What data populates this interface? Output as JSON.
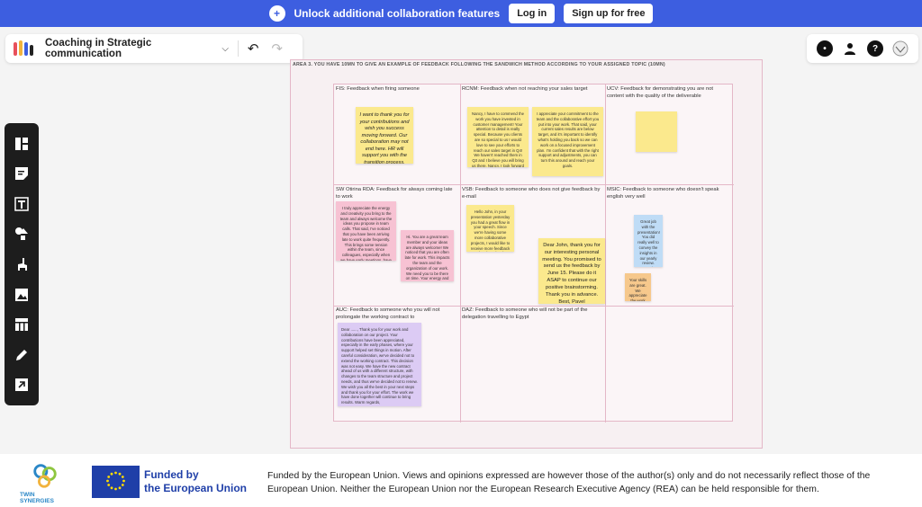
{
  "banner": {
    "text": "Unlock additional collaboration features",
    "login": "Log in",
    "signup": "Sign up for free"
  },
  "header": {
    "title": "Coaching in Strategic communication"
  },
  "colors": {
    "banner": "#3d5ee0",
    "yellow_note": "#fbe98d",
    "pink_note": "#f7c2d3",
    "blue_note": "#bfdcf6",
    "violet_note": "#dccbf4",
    "orange_note": "#f6c88c"
  },
  "icons": {
    "banner": "person-plus-icon",
    "header_right": [
      "comment-icon",
      "user-icon",
      "help-icon",
      "avatar-icon"
    ],
    "toolbar": [
      "layout-icon",
      "sticky-note-icon",
      "text-icon",
      "shapes-icon",
      "llama-icon",
      "image-icon",
      "table-icon",
      "pen-icon",
      "upload-icon"
    ]
  },
  "board": {
    "frame_title": "AREA 3.     YOU HAVE 10MN TO GIVE AN EXAMPLE OF FEEDBACK FOLLOWING THE SANDWICH METHOD ACCORDING TO YOUR ASSIGNED TOPIC (10MN)",
    "cells": [
      "FIS: Feedback when firing someone",
      "RCNM: Feedback when not reaching your sales target",
      "UCV: Feedback for demonstrating you are not content with the quality of the deliverable",
      "SW Otirina RDA: Feedback for always coming late to work",
      "VSB: Feedback to someone who does not give feedback by e-mail",
      "MSIC: Feedback to someone who doesn't speak english very well",
      "AUC: Feedback to someone who you will not prolongate the working contract to",
      "DAZ: Feedback to someone who will not be part of the delegation travelling to Egypt"
    ],
    "notes": {
      "fis": "I want to thank you for your contributions and wish you success moving forward. Our collaboration may not end here. HR will support you with the transition process.",
      "rcnm_1": "Nancy, I have to commend the work you have invested in customer management! Your attention to detail is really special. Because you clients are so special to us I would love to see your efforts to reach our sales target in Q4! We haven't reached them in Q3 and I believe you will bring us there. Nancy, I look forward to your feedback.",
      "rcnm_2": "I appreciate your commitment to the team and the collaborative effort you put into your work. That said, your current sales results are below target, and it's important to identify what's holding you back so we can work on a focused improvement plan. I'm confident that with the right support and adjustments, you can turn this around and reach your goals.",
      "sw_1": "I truly appreciate the energy and creativity you bring to the team and always welcome the ideas you propose in team calls. That said, I've noticed that you have been arriving late to work quite frequently. This brings some tension within the team, since colleagues, especially when we have early meetings, have to wait for you. I am confident that you can make this adjustment and continue the great work you are doing.",
      "sw_2": "Hi. You are a great team member and your ideas are always welcome! We noticed that you are often late for work. This impacts the team and the organization of our work. We need you to be there on time. Your energy and talent are very much needed in the team. If there is something that keeps you from coming in on time, please let us know.",
      "vsb_1": "Hello John, in your presentation yesterday you had a great flow in your speech. Since we're having some more collaborative projects, I would like to receive more feedback on the shared tasks. Your feedback is important to me and our teamwork. I appreciate your input and look forward to working together with you. Best regards",
      "vsb_2": "Dear John, thank you for our interesting personal meeting. You promised to send us the feedback by June 15. Please do it ASAP to continue our positive brainstorming. Thank you in advance. Best, Pavel",
      "msic_1": "Great job with the presentation! You did really well to convey the insights in our yearly review. Improving your English language skills would help you communicate those insights even more easily to a wider team. There are courses to help you grow, and the company supports you with them. We value the contribution you make to the team, and I'm confident that you will be even more successful in the future. Thank you for the beautiful presentation!",
      "msic_2": "Your skills are great. We appreciate the work you do. We would support you in improving your English so that the communication flows easier. Thank you.",
      "auc": "Dear ......, Thank you for your work and collaboration on our project. Your contributions have been appreciated, especially in the early phases, where your support helped set things in motion. After careful consideration, we've decided not to extend the working contract. This decision was not easy. We have the new contract ahead of us with a different structure, with changes to the team structure and project needs, and thus we've decided not to renew. We wish you all the best in your next steps and thank you for your effort. The work we have done together will continue to bring results. Warm regards,"
    }
  },
  "footer": {
    "twin_label": "TWIN SYNERGIES",
    "funded_line1": "Funded by",
    "funded_line2": "the European Union",
    "disclaimer": "Funded by the European Union. Views and opinions expressed are however those of the author(s) only and do not necessarily reflect those of the European Union. Neither the European Union nor the European Research Executive Agency (REA) can be held responsible for them."
  }
}
